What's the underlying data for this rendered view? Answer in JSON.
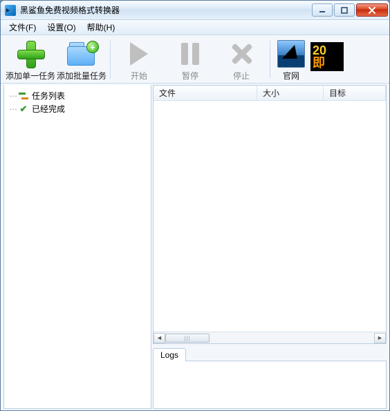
{
  "window": {
    "title": "黑鲨鱼免费视频格式转换器"
  },
  "menu": {
    "file": "文件(F)",
    "settings": "设置(O)",
    "help": "帮助(H)"
  },
  "toolbar": {
    "add_single": "添加单一任务",
    "add_batch": "添加批量任务",
    "start": "开始",
    "pause": "暂停",
    "stop": "停止",
    "website": "官网",
    "banner_line1": "20",
    "banner_line2": "即"
  },
  "tree": {
    "task_list": "任务列表",
    "completed": "已经完成"
  },
  "columns": {
    "file": "文件",
    "size": "大小",
    "target": "目标"
  },
  "logs": {
    "tab": "Logs"
  }
}
